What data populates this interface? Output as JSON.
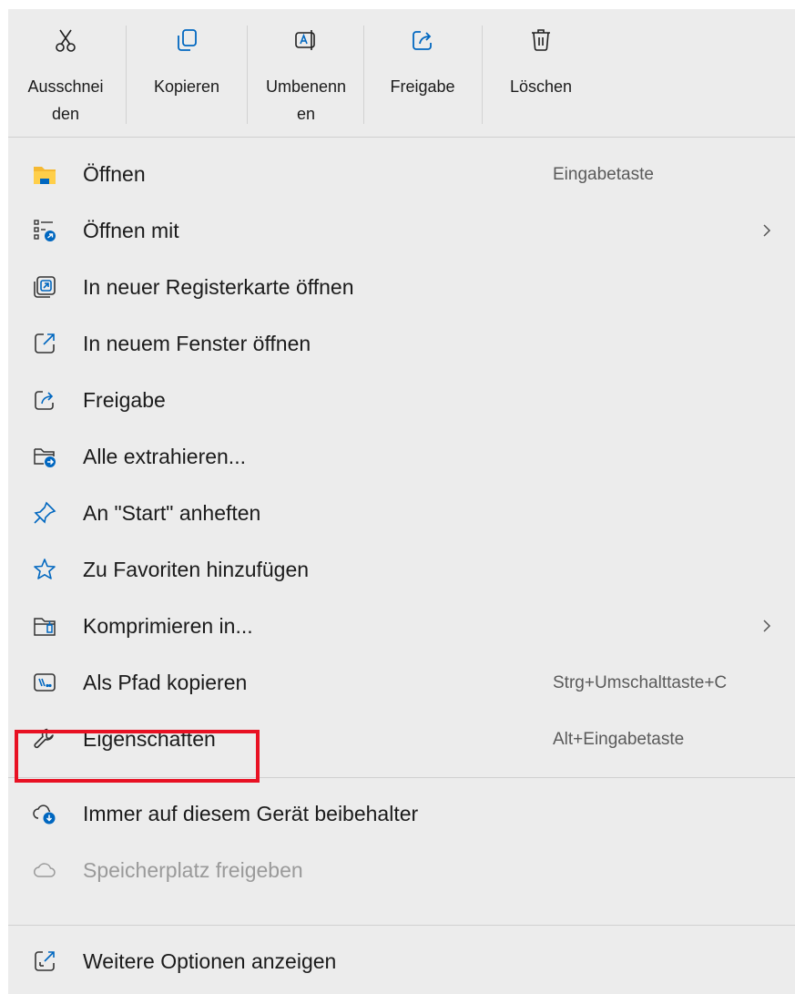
{
  "toolbar": {
    "cut": "Ausschnei\nden",
    "copy": "Kopieren",
    "rename": "Umbenenn\nen",
    "share": "Freigabe",
    "delete": "Löschen"
  },
  "items": [
    {
      "label": "Öffnen",
      "shortcut": "Eingabetaste",
      "icon": "folder-icon"
    },
    {
      "label": "Öffnen mit",
      "submenu": true,
      "icon": "open-with-icon"
    },
    {
      "label": "In neuer Registerkarte öffnen",
      "icon": "new-tab-icon"
    },
    {
      "label": "In neuem Fenster öffnen",
      "icon": "new-window-icon"
    },
    {
      "label": "Freigabe",
      "icon": "share-icon"
    },
    {
      "label": "Alle extrahieren...",
      "icon": "extract-icon"
    },
    {
      "label": "An \"Start\" anheften",
      "icon": "pin-icon"
    },
    {
      "label": "Zu Favoriten hinzufügen",
      "icon": "star-icon"
    },
    {
      "label": "Komprimieren in...",
      "submenu": true,
      "icon": "zip-folder-icon"
    },
    {
      "label": "Als Pfad kopieren",
      "shortcut": "Strg+Umschalttaste+C",
      "icon": "copy-path-icon"
    },
    {
      "label": "Eigenschaften",
      "shortcut": "Alt+Eingabetaste",
      "icon": "wrench-icon"
    },
    {
      "label": "Immer auf diesem Gerät beibehalter",
      "icon": "cloud-download-icon"
    },
    {
      "label": "Speicherplatz freigeben",
      "disabled": true,
      "icon": "cloud-icon"
    },
    {
      "label": "Weitere Optionen anzeigen",
      "icon": "more-options-icon"
    }
  ],
  "colors": {
    "menu_bg": "#ececec",
    "accent": "#0067c0",
    "highlight": "#e81123"
  }
}
